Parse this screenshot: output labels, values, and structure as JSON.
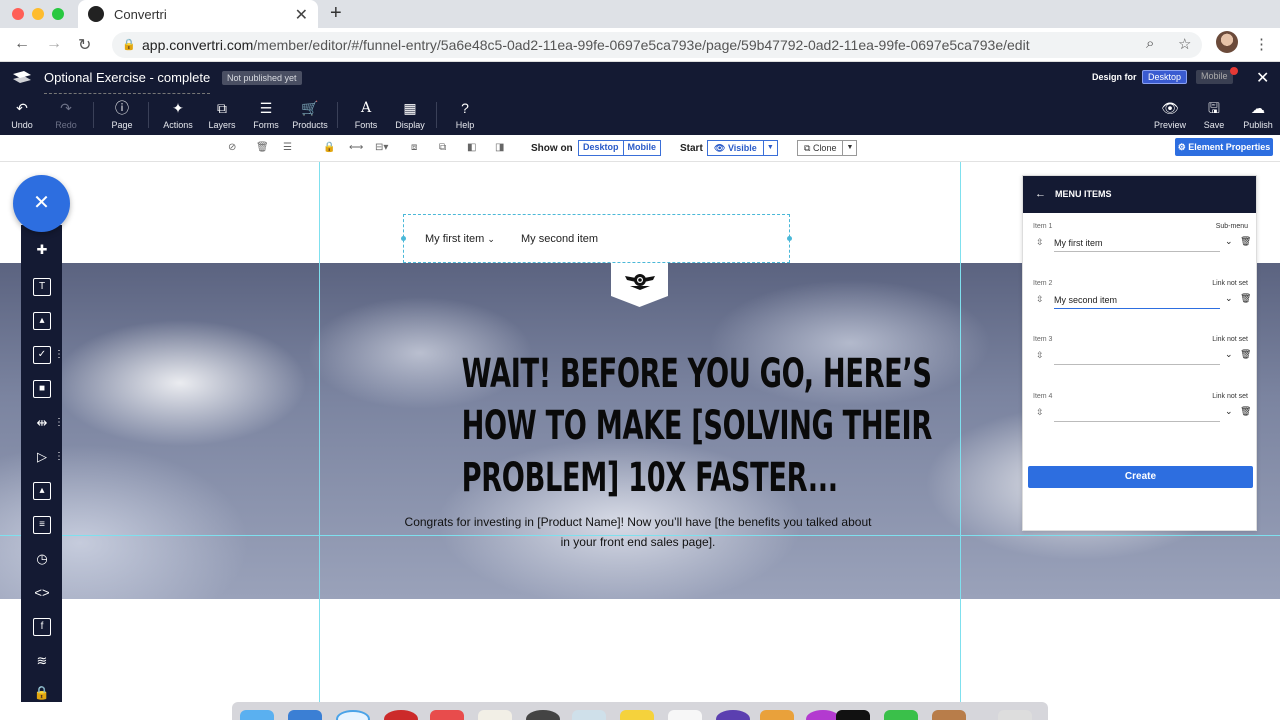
{
  "browser": {
    "tab_title": "Convertri",
    "url_host": "app.convertri.com",
    "url_path": "/member/editor/#/funnel-entry/5a6e48c5-0ad2-11ea-99fe-0697e5ca793e/page/59b47792-0ad2-11ea-99fe-0697e5ca793e/edit"
  },
  "editor": {
    "page_title": "Optional Exercise - complete",
    "publish_status": "Not published yet",
    "tools": [
      {
        "label": "Undo"
      },
      {
        "label": "Redo"
      },
      {
        "label": "Page"
      },
      {
        "label": "Actions"
      },
      {
        "label": "Layers"
      },
      {
        "label": "Forms"
      },
      {
        "label": "Products"
      },
      {
        "label": "Fonts"
      },
      {
        "label": "Display"
      },
      {
        "label": "Help"
      },
      {
        "label": "Preview"
      },
      {
        "label": "Save"
      },
      {
        "label": "Publish"
      }
    ],
    "design_for_label": "Design for",
    "design_desktop": "Desktop",
    "design_mobile": "Mobile"
  },
  "subbar": {
    "show_on_label": "Show on",
    "show_desktop": "Desktop",
    "show_mobile": "Mobile",
    "start_label": "Start",
    "visible_option": "Visible",
    "clone_label": "Clone",
    "element_properties": "Element Properties"
  },
  "canvas": {
    "menu_items": [
      "My first item",
      "My second item"
    ],
    "headline_lines": [
      "WAIT! BEFORE YOU GO, HERE’S",
      "HOW TO MAKE [SOLVING THEIR",
      "PROBLEM] 10X FASTER..."
    ],
    "subtext": "Congrats for investing in [Product Name]! Now you’ll have [the benefits you talked about in your front end sales page]."
  },
  "menu_panel": {
    "title": "MENU ITEMS",
    "items": [
      {
        "label": "Item 1",
        "link": "Sub-menu",
        "value": "My first item"
      },
      {
        "label": "Item 2",
        "link": "Link not set",
        "value": "My second item"
      },
      {
        "label": "Item 3",
        "link": "Link not set",
        "value": ""
      },
      {
        "label": "Item 4",
        "link": "Link not set",
        "value": ""
      }
    ],
    "create_label": "Create"
  },
  "colors": {
    "editor_dark": "#141a33",
    "accent_blue": "#2d6ee0",
    "guide_cyan": "#7fe0ee"
  }
}
